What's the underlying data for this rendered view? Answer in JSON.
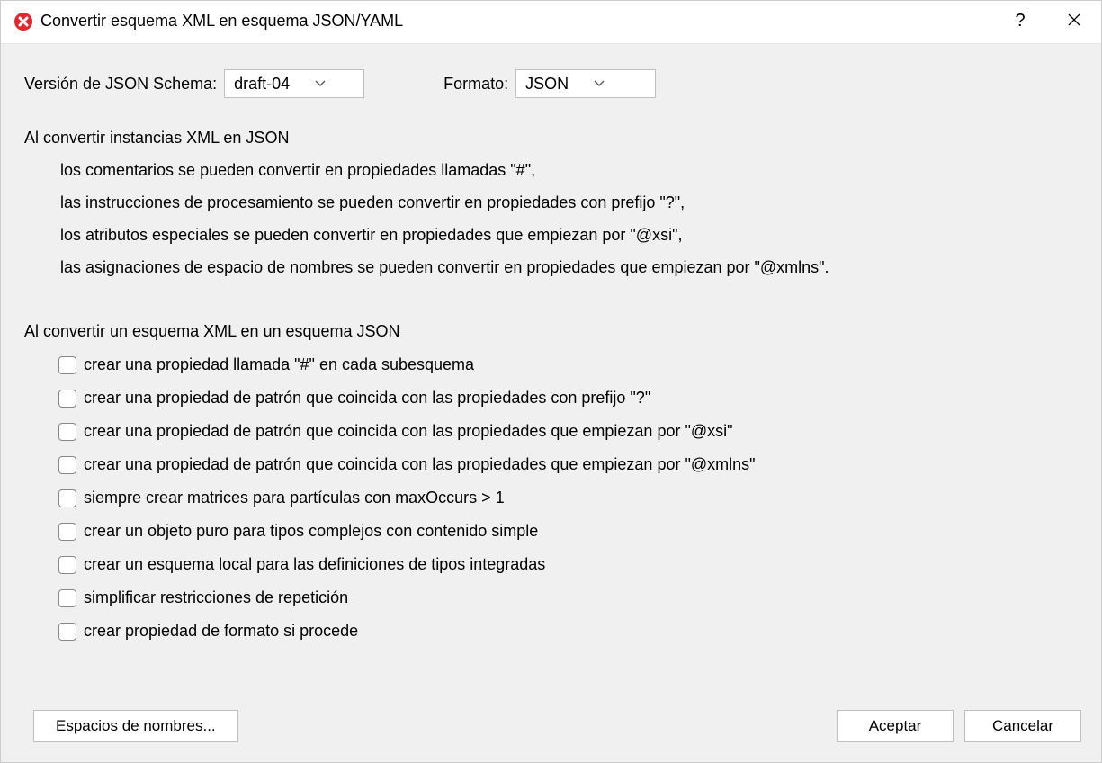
{
  "titlebar": {
    "title": "Convertir esquema XML en esquema JSON/YAML",
    "help_label": "?",
    "close_label": "✕"
  },
  "top": {
    "version_label": "Versión de JSON Schema:",
    "version_value": "draft-04",
    "format_label": "Formato:",
    "format_value": "JSON"
  },
  "section1": {
    "heading": "Al convertir instancias XML en JSON",
    "lines": [
      "los comentarios se pueden convertir en propiedades llamadas \"#\",",
      "las instrucciones de procesamiento se pueden convertir en propiedades con prefijo \"?\",",
      "los atributos especiales se pueden convertir en propiedades que empiezan por \"@xsi\",",
      "las asignaciones de espacio de nombres se pueden convertir en propiedades que empiezan por \"@xmlns\"."
    ]
  },
  "section2": {
    "heading": "Al convertir un esquema XML en un esquema JSON",
    "options": [
      "crear una propiedad llamada \"#\" en cada subesquema",
      "crear una propiedad de patrón que coincida con las propiedades con prefijo \"?\"",
      "crear una propiedad de patrón que coincida con las propiedades que empiezan por \"@xsi\"",
      "crear una propiedad de patrón que coincida con las propiedades que empiezan por \"@xmlns\"",
      "siempre crear matrices para partículas con maxOccurs > 1",
      "crear un objeto puro para tipos complejos con contenido simple",
      "crear un esquema local para las definiciones de tipos integradas",
      "simplificar restricciones de repetición",
      "crear propiedad de formato si procede"
    ]
  },
  "footer": {
    "namespaces_label": "Espacios de nombres...",
    "ok_label": "Aceptar",
    "cancel_label": "Cancelar"
  }
}
